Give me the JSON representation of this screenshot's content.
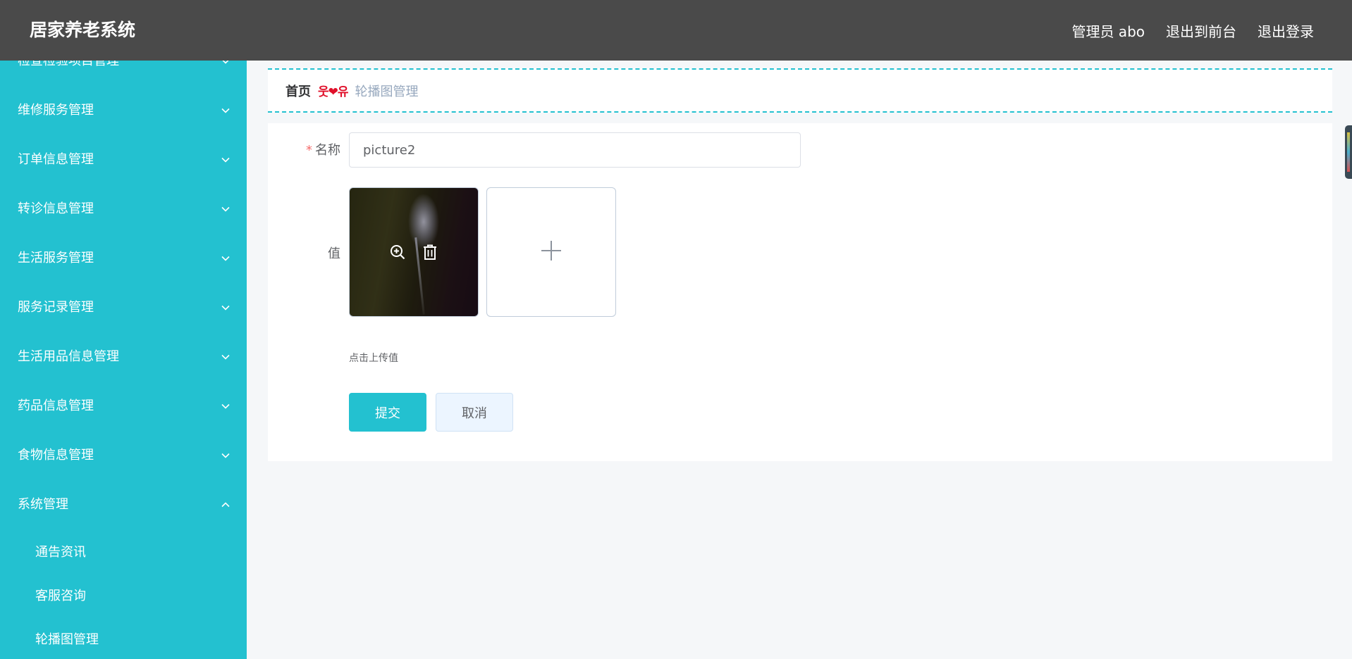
{
  "header": {
    "title": "居家养老系统",
    "user_label": "管理员 abo",
    "to_front_label": "退出到前台",
    "logout_label": "退出登录"
  },
  "sidebar": {
    "items": [
      {
        "label": "检查检验项目管理"
      },
      {
        "label": "维修服务管理"
      },
      {
        "label": "订单信息管理"
      },
      {
        "label": "转诊信息管理"
      },
      {
        "label": "生活服务管理"
      },
      {
        "label": "服务记录管理"
      },
      {
        "label": "生活用品信息管理"
      },
      {
        "label": "药品信息管理"
      },
      {
        "label": "食物信息管理"
      },
      {
        "label": "系统管理"
      }
    ],
    "sub_items": [
      {
        "label": "通告资讯"
      },
      {
        "label": "客服咨询"
      },
      {
        "label": "轮播图管理"
      }
    ]
  },
  "breadcrumb": {
    "home": "首页",
    "separator": "웃❤유",
    "current": "轮播图管理"
  },
  "form": {
    "name_label": "名称",
    "required_mark": "*",
    "name_value": "picture2",
    "value_label": "值",
    "upload_hint": "点击上传值",
    "submit_label": "提交",
    "cancel_label": "取消"
  },
  "colors": {
    "header_bg": "#4a4a4a",
    "sidebar_bg": "#23c1d0",
    "accent": "#23c1d0",
    "required": "#f56c6c",
    "separator": "#e0102a"
  },
  "icons": {
    "menu_collapsed": "chevron-down-icon",
    "menu_expanded": "chevron-up-icon",
    "preview": "zoom-in-icon",
    "delete": "trash-icon",
    "upload": "plus-icon"
  }
}
